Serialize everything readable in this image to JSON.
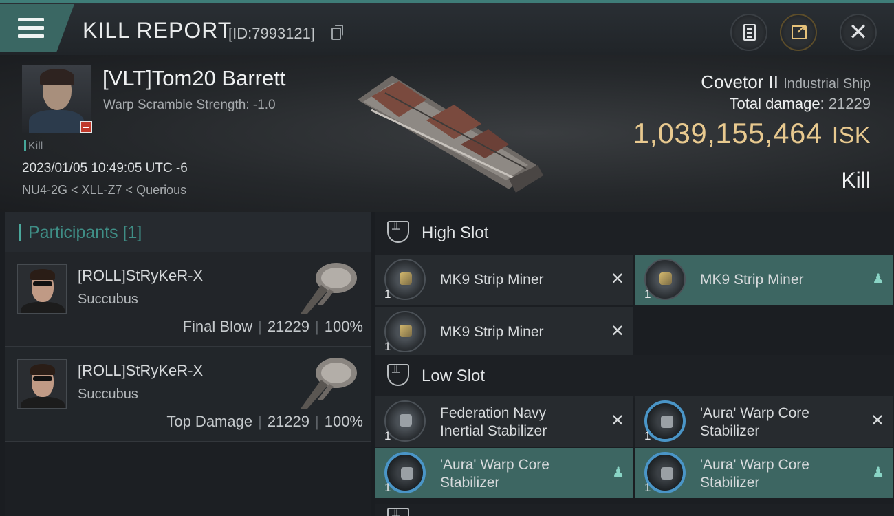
{
  "header": {
    "title": "KILL REPORT",
    "report_id": "[ID:7993121]"
  },
  "victim": {
    "name": "[VLT]Tom20 Barrett",
    "warp_scramble": "Warp Scramble Strength: -1.0",
    "tag": "Kill",
    "timestamp": "2023/01/05 10:49:05 UTC -6",
    "location": "NU4-2G < XLL-Z7 < Querious"
  },
  "ship": {
    "name": "Covetor II",
    "class": "Industrial Ship",
    "total_damage_label": "Total damage:",
    "total_damage": "21229",
    "value": "1,039,155,464",
    "currency": "ISK",
    "result": "Kill"
  },
  "participants": {
    "header": "Participants [1]",
    "rows": [
      {
        "name": "[ROLL]StRyKeR-X",
        "ship": "Succubus",
        "role": "Final Blow",
        "damage": "21229",
        "percent": "100%"
      },
      {
        "name": "[ROLL]StRyKeR-X",
        "ship": "Succubus",
        "role": "Top Damage",
        "damage": "21229",
        "percent": "100%"
      }
    ]
  },
  "fitting": {
    "high_slot": {
      "label": "High Slot",
      "modules": [
        {
          "qty": "1",
          "name": "MK9 Strip Miner",
          "status": "destroyed",
          "icon": "strip-miner-icon"
        },
        {
          "qty": "1",
          "name": "MK9 Strip Miner",
          "status": "dropped",
          "icon": "strip-miner-icon"
        },
        {
          "qty": "1",
          "name": "MK9 Strip Miner",
          "status": "destroyed",
          "icon": "strip-miner-icon"
        }
      ]
    },
    "low_slot": {
      "label": "Low Slot",
      "modules": [
        {
          "qty": "1",
          "name_line1": "Federation Navy",
          "name_line2": "Inertial Stabilizer",
          "status": "destroyed",
          "icon": "inertial-stabilizer-icon"
        },
        {
          "qty": "1",
          "name_line1": "'Aura' Warp Core",
          "name_line2": "Stabilizer",
          "status": "destroyed",
          "icon": "warp-core-stabilizer-icon"
        },
        {
          "qty": "1",
          "name_line1": "'Aura' Warp Core",
          "name_line2": "Stabilizer",
          "status": "dropped",
          "icon": "warp-core-stabilizer-icon"
        },
        {
          "qty": "1",
          "name_line1": "'Aura' Warp Core",
          "name_line2": "Stabilizer",
          "status": "dropped",
          "icon": "warp-core-stabilizer-icon"
        }
      ]
    }
  },
  "icons": {
    "destroyed": "✕",
    "dropped": "👤"
  },
  "colors": {
    "accent": "#3f7d78",
    "isk_gold": "#e8c98f",
    "dropped_bg": "#3d6662"
  }
}
